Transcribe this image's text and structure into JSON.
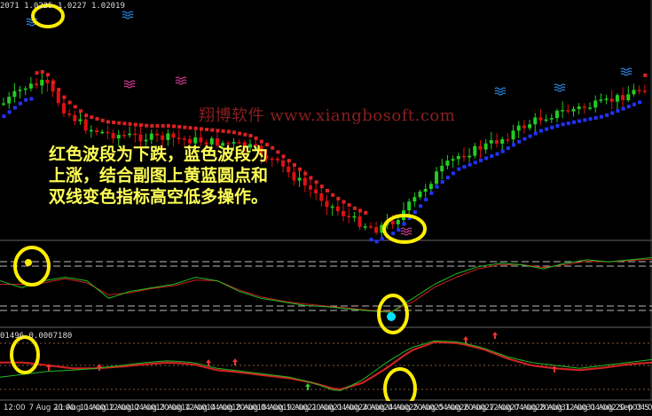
{
  "header": {
    "main_text": "2071 1.0225 1.0227 1.02019",
    "sub3_text": "01496 0.0007180"
  },
  "watermark": "翔博软件 www.xiangbosoft.com",
  "note_lines": [
    "红色波段为下跌，蓝色波段为",
    "上涨，结合副图上黄蓝圆点和",
    "双线变色指标高空低多操作。"
  ],
  "colors": {
    "background": "#000000",
    "bull_candle": "#22cc22",
    "bear_candle": "#dd1111",
    "band_down": "#dd2222",
    "band_up": "#2233ff",
    "osc_green": "#22bb22",
    "osc_red": "#cc2222",
    "highlight_ring": "#ffee00",
    "cyan_dot": "#00e5ff",
    "wave_blue": "#3399ff",
    "wave_pink": "#ee44aa"
  },
  "chart_data": {
    "type": "candlestick",
    "x_tick_labels": [
      "7 Aug 20:00",
      "11 Aug 04:00",
      "11 Aug 12:00",
      "12 Aug 04:00",
      "12 Aug 20:00",
      "13 Aug 12:00",
      "14 Aug 04:00",
      "14 Aug 20:00",
      "18 Aug 04:00",
      "18 Aug 12:00",
      "19 Aug 20:00",
      "21 Aug 04:00",
      "21 Aug 20:00",
      "24 Aug 04:00",
      "24 Aug 20:00",
      "25 Aug 04:00",
      "25 Aug 20:00",
      "26 Aug 12:00",
      "27 Aug 04:00",
      "27 Aug 20:00",
      "28 Aug 12:00",
      "31 Aug 04:00",
      "31 Aug 20:00",
      "2 Sep 04:00",
      "3 S"
    ],
    "first_tick_label": "12:00",
    "price_trend": [
      0.62,
      0.7,
      0.72,
      0.58,
      0.5,
      0.47,
      0.46,
      0.45,
      0.45,
      0.44,
      0.43,
      0.42,
      0.4,
      0.34,
      0.26,
      0.18,
      0.1,
      0.04,
      0.0,
      0.05,
      0.16,
      0.28,
      0.36,
      0.4,
      0.44,
      0.5,
      0.55,
      0.58,
      0.6,
      0.62,
      0.66,
      0.7
    ],
    "osc1": {
      "upper_levels": 2,
      "lower_levels": 2,
      "green": [
        0.55,
        0.45,
        0.55,
        0.6,
        0.55,
        0.3,
        0.4,
        0.45,
        0.5,
        0.6,
        0.55,
        0.4,
        0.3,
        0.25,
        0.2,
        0.18,
        0.15,
        0.12,
        0.1,
        0.3,
        0.5,
        0.65,
        0.75,
        0.8,
        0.78,
        0.72,
        0.8,
        0.85,
        0.82,
        0.85,
        0.88
      ],
      "red": [
        0.5,
        0.5,
        0.52,
        0.58,
        0.52,
        0.35,
        0.38,
        0.44,
        0.48,
        0.56,
        0.55,
        0.42,
        0.32,
        0.26,
        0.22,
        0.19,
        0.16,
        0.13,
        0.11,
        0.25,
        0.46,
        0.6,
        0.72,
        0.78,
        0.78,
        0.74,
        0.78,
        0.83,
        0.82,
        0.84,
        0.86
      ]
    },
    "osc2": {
      "green": [
        0.3,
        0.35,
        0.4,
        0.42,
        0.45,
        0.5,
        0.55,
        0.58,
        0.55,
        0.45,
        0.4,
        0.35,
        0.3,
        0.2,
        0.05,
        0.25,
        0.55,
        0.8,
        0.92,
        0.9,
        0.8,
        0.65,
        0.55,
        0.5,
        0.45,
        0.5,
        0.55,
        0.6
      ],
      "red": [
        0.55,
        0.55,
        0.5,
        0.45,
        0.45,
        0.48,
        0.52,
        0.55,
        0.52,
        0.42,
        0.38,
        0.33,
        0.28,
        0.2,
        0.08,
        0.2,
        0.45,
        0.75,
        0.9,
        0.88,
        0.78,
        0.62,
        0.5,
        0.45,
        0.42,
        0.46,
        0.52,
        0.55
      ]
    }
  }
}
